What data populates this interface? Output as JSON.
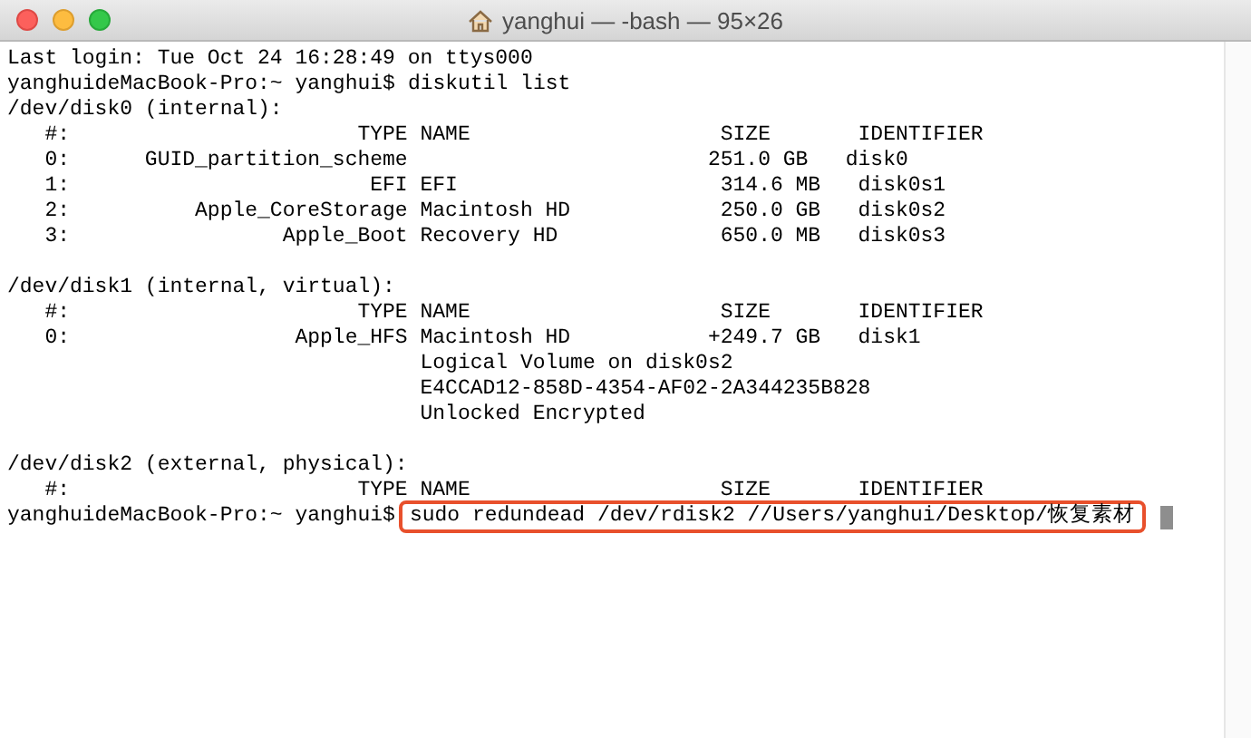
{
  "window": {
    "title": "yanghui — -bash — 95×26"
  },
  "terminal": {
    "lines": [
      {
        "kind": "output",
        "text": "Last login: Tue Oct 24 16:28:49 on ttys000"
      },
      {
        "kind": "prompt",
        "prompt": "yanghuideMacBook-Pro:~ yanghui$",
        "command": "diskutil list",
        "highlighted": false,
        "cursor": false
      },
      {
        "kind": "output",
        "text": "/dev/disk0 (internal):"
      },
      {
        "kind": "output",
        "text": "   #:                       TYPE NAME                    SIZE       IDENTIFIER"
      },
      {
        "kind": "output",
        "text": "   0:      GUID_partition_scheme                        251.0 GB   disk0"
      },
      {
        "kind": "output",
        "text": "   1:                        EFI EFI                     314.6 MB   disk0s1"
      },
      {
        "kind": "output",
        "text": "   2:          Apple_CoreStorage Macintosh HD            250.0 GB   disk0s2"
      },
      {
        "kind": "output",
        "text": "   3:                 Apple_Boot Recovery HD             650.0 MB   disk0s3"
      },
      {
        "kind": "blank"
      },
      {
        "kind": "output",
        "text": "/dev/disk1 (internal, virtual):"
      },
      {
        "kind": "output",
        "text": "   #:                       TYPE NAME                    SIZE       IDENTIFIER"
      },
      {
        "kind": "output",
        "text": "   0:                  Apple_HFS Macintosh HD           +249.7 GB   disk1"
      },
      {
        "kind": "output",
        "text": "                                 Logical Volume on disk0s2"
      },
      {
        "kind": "output",
        "text": "                                 E4CCAD12-858D-4354-AF02-2A344235B828"
      },
      {
        "kind": "output",
        "text": "                                 Unlocked Encrypted"
      },
      {
        "kind": "blank"
      },
      {
        "kind": "output",
        "text": "/dev/disk2 (external, physical):"
      },
      {
        "kind": "output",
        "text": "   #:                       TYPE NAME                    SIZE       IDENTIFIER"
      },
      {
        "kind": "prompt",
        "prompt": "yanghuideMacBook-Pro:~ yanghui$",
        "command": "sudo redundead /dev/rdisk2 //Users/yanghui/Desktop/恢复素材",
        "highlighted": true,
        "cursor": true
      }
    ]
  }
}
